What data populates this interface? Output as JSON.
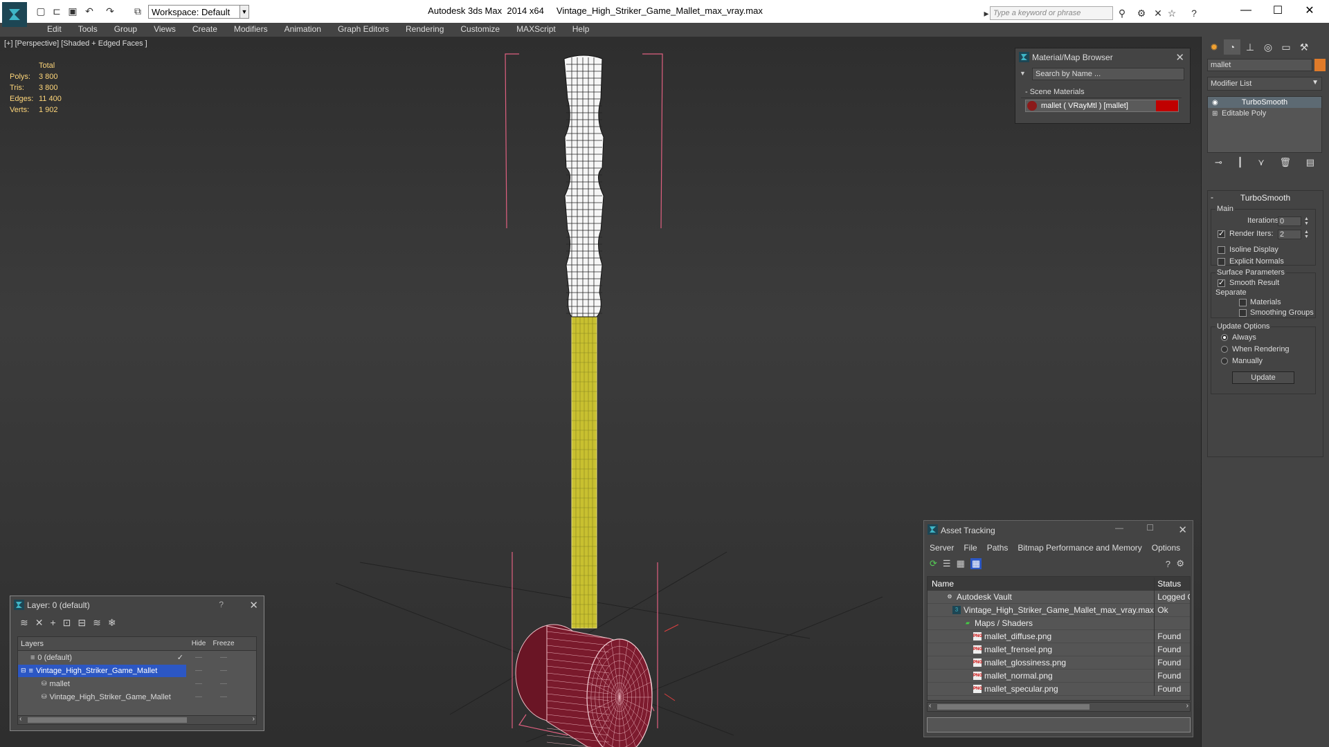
{
  "window": {
    "title": "Autodesk 3ds Max  2014 x64     Vintage_High_Striker_Game_Mallet_max_vray.max",
    "workspace": "Workspace: Default",
    "search_placeholder": "Type a keyword or phrase"
  },
  "menu": [
    "Edit",
    "Tools",
    "Group",
    "Views",
    "Create",
    "Modifiers",
    "Animation",
    "Graph Editors",
    "Rendering",
    "Customize",
    "MAXScript",
    "Help"
  ],
  "viewport": {
    "label": "[+] [Perspective] [Shaded + Edged Faces ]",
    "stats": {
      "header": "Total",
      "rows": [
        {
          "k": "Polys:",
          "v": "3 800"
        },
        {
          "k": "Tris:",
          "v": "3 800"
        },
        {
          "k": "Edges:",
          "v": "11 400"
        },
        {
          "k": "Verts:",
          "v": "1 902"
        }
      ]
    }
  },
  "material_browser": {
    "title": "Material/Map Browser",
    "search": "Search by Name ...",
    "section": "- Scene Materials",
    "item": "mallet  ( VRayMtl ) [mallet]"
  },
  "command_panel": {
    "object_name": "mallet",
    "modifier_list": "Modifier List",
    "stack": [
      "TurboSmooth",
      "Editable Poly"
    ],
    "turbosmooth": {
      "title": "TurboSmooth",
      "main": "Main",
      "iterations_label": "Iterations:",
      "iterations": "0",
      "render_iters_label": "Render Iters:",
      "render_iters": "2",
      "isoline": "Isoline Display",
      "explicit": "Explicit Normals",
      "surface": "Surface Parameters",
      "smooth_result": "Smooth Result",
      "separate": "Separate",
      "materials": "Materials",
      "smoothing_groups": "Smoothing Groups",
      "update_options": "Update Options",
      "always": "Always",
      "when_rendering": "When Rendering",
      "manually": "Manually",
      "update": "Update"
    }
  },
  "layer_panel": {
    "title": "Layer: 0 (default)",
    "help": "?",
    "cols": {
      "layers": "Layers",
      "hide": "Hide",
      "freeze": "Freeze"
    },
    "rows": [
      {
        "name": "0 (default)"
      },
      {
        "name": "Vintage_High_Striker_Game_Mallet"
      },
      {
        "name": "mallet"
      },
      {
        "name": "Vintage_High_Striker_Game_Mallet"
      }
    ]
  },
  "asset_tracking": {
    "title": "Asset Tracking",
    "menu": [
      "Server",
      "File",
      "Paths",
      "Bitmap Performance and Memory",
      "Options"
    ],
    "cols": {
      "name": "Name",
      "status": "Status"
    },
    "rows": [
      {
        "name": "Autodesk Vault",
        "status": "Logged O"
      },
      {
        "name": "Vintage_High_Striker_Game_Mallet_max_vray.max",
        "status": "Ok"
      },
      {
        "name": "Maps / Shaders",
        "status": ""
      },
      {
        "name": "mallet_diffuse.png",
        "status": "Found"
      },
      {
        "name": "mallet_frensel.png",
        "status": "Found"
      },
      {
        "name": "mallet_glossiness.png",
        "status": "Found"
      },
      {
        "name": "mallet_normal.png",
        "status": "Found"
      },
      {
        "name": "mallet_specular.png",
        "status": "Found"
      }
    ]
  },
  "colors": {
    "selection": "#2c57c4",
    "stats": "#ffd77a",
    "handle_wire": "#e8e07a",
    "head_wire": "#9b2a3a",
    "bbox": "#e06080"
  }
}
